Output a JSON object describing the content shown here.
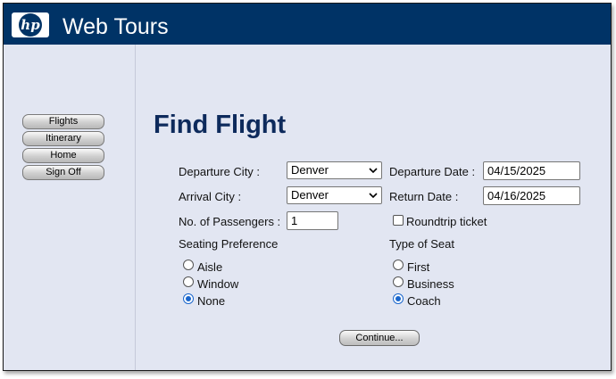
{
  "app": {
    "logo_text": "hp",
    "title": "Web Tours"
  },
  "sidebar": {
    "items": [
      {
        "label": "Flights"
      },
      {
        "label": "Itinerary"
      },
      {
        "label": "Home"
      },
      {
        "label": "Sign Off"
      }
    ]
  },
  "form": {
    "heading": "Find Flight",
    "departure_city": {
      "label": "Departure City :",
      "value": "Denver"
    },
    "departure_date": {
      "label": "Departure Date :",
      "value": "04/15/2025"
    },
    "arrival_city": {
      "label": "Arrival City :",
      "value": "Denver"
    },
    "return_date": {
      "label": "Return Date :",
      "value": "04/16/2025"
    },
    "passengers": {
      "label": "No. of Passengers :",
      "value": "1"
    },
    "roundtrip": {
      "label": "Roundtrip ticket",
      "checked": false
    },
    "seating_preference": {
      "label": "Seating Preference",
      "options": [
        "Aisle",
        "Window",
        "None"
      ],
      "selected": "None"
    },
    "type_of_seat": {
      "label": "Type of Seat",
      "options": [
        "First",
        "Business",
        "Coach"
      ],
      "selected": "Coach"
    },
    "continue_label": "Continue..."
  },
  "colors": {
    "header_bg": "#003366",
    "page_bg": "#e2e6f2",
    "heading": "#0d2a5c",
    "radio_selected": "#1a66cc"
  }
}
